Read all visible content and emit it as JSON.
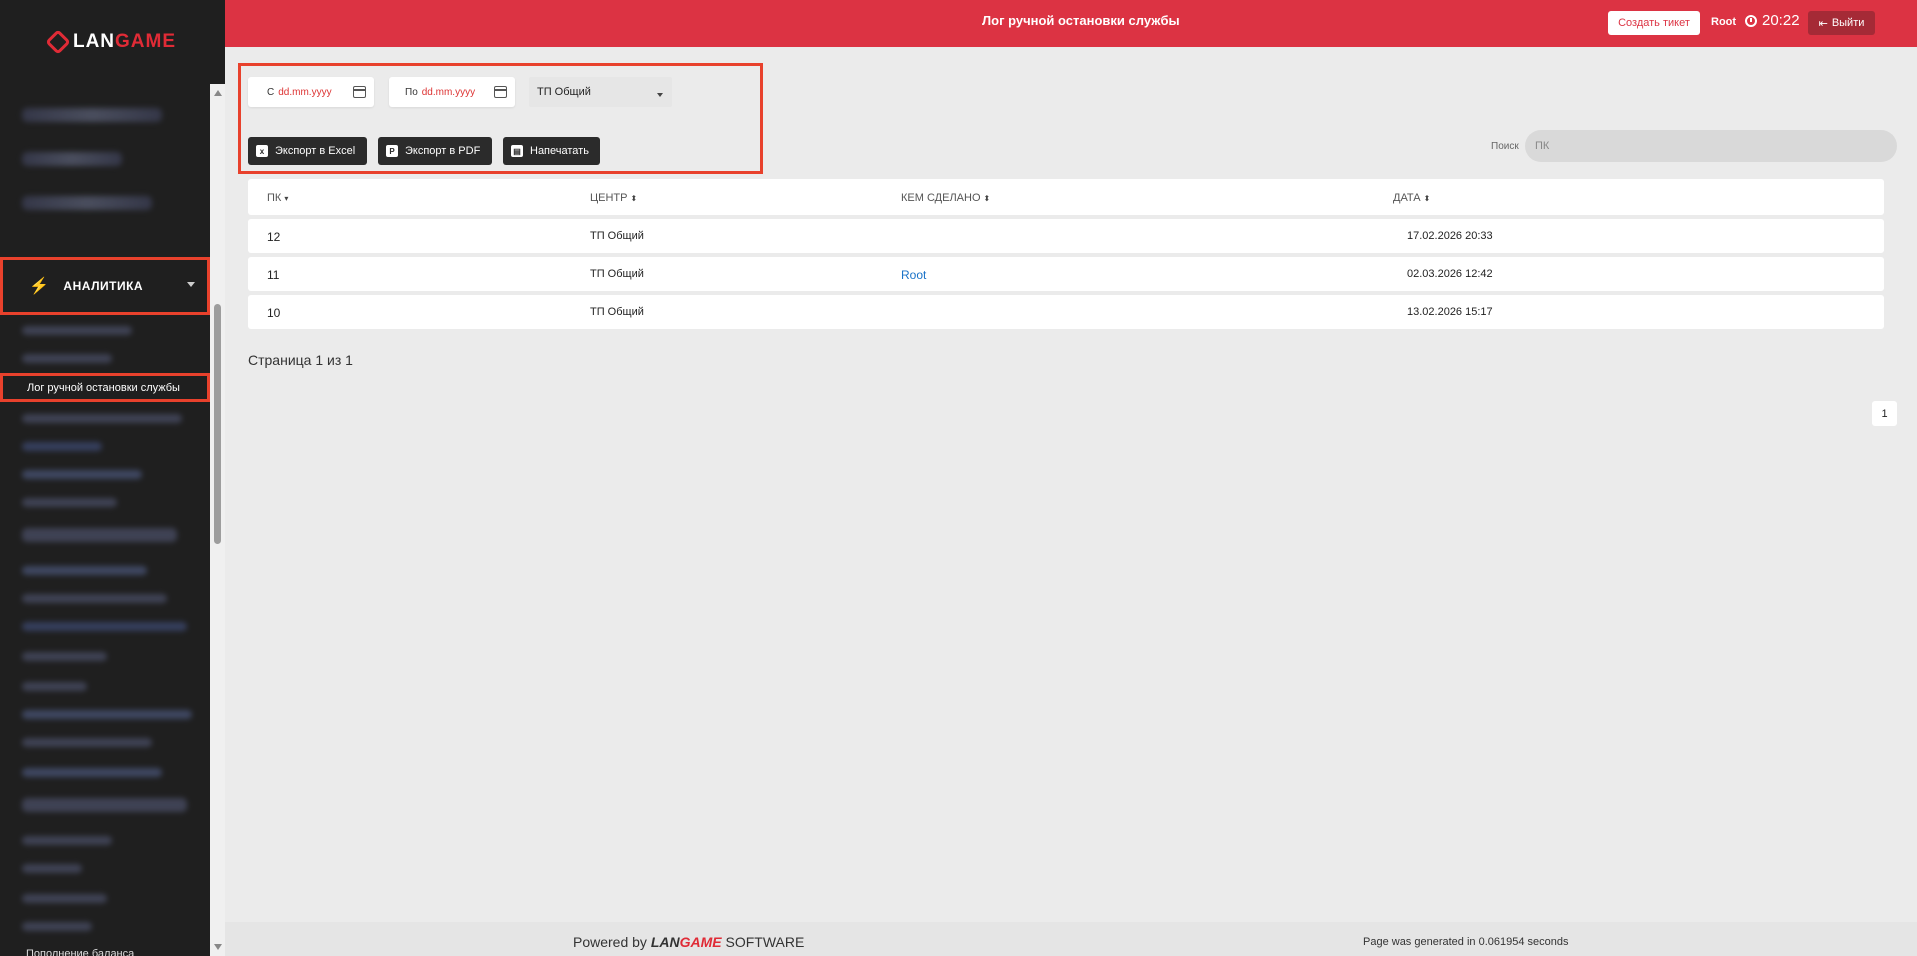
{
  "app": {
    "logo": {
      "prefix": "LAN",
      "accent": "GAME"
    },
    "brand_color": "#dc3343",
    "highlight_color": "#e8412c"
  },
  "sidebar": {
    "section_label": "АНАЛИТИКА",
    "section_icon": "bolt-icon",
    "active_item": "Лог ручной остановки службы",
    "footer_text": "Пополнение баланса"
  },
  "header": {
    "title": "Лог ручной остановки службы",
    "create_ticket_label": "Создать тикет",
    "user": "Root",
    "time": "20:22",
    "logout_label": "Выйти"
  },
  "filters": {
    "date_from": {
      "prefix": "С",
      "placeholder": "dd.mm.yyyy"
    },
    "date_to": {
      "prefix": "По",
      "placeholder": "dd.mm.yyyy"
    },
    "center_select": "ТП Общий",
    "export_excel_label": "Экспорт в Excel",
    "export_pdf_label": "Экспорт в PDF",
    "print_label": "Напечатать"
  },
  "search": {
    "label": "Поиск",
    "placeholder": "ПК"
  },
  "table": {
    "headers": [
      "ПК",
      "ЦЕНТР",
      "КЕМ СДЕЛАНО",
      "ДАТА"
    ],
    "rows": [
      {
        "pk": "12",
        "center": "ТП Общий",
        "by": "",
        "date": "17.02.2026 20:33"
      },
      {
        "pk": "11",
        "center": "ТП Общий",
        "by": "Root",
        "date": "02.03.2026 12:42"
      },
      {
        "pk": "10",
        "center": "ТП Общий",
        "by": "",
        "date": "13.02.2026 15:17"
      }
    ]
  },
  "pagination": {
    "info": "Страница 1 из 1",
    "current_page": "1"
  },
  "footer": {
    "powered_prefix": "Powered by",
    "brand_prefix": "LAN",
    "brand_accent": "GAME",
    "suffix": "SOFTWARE",
    "generated": "Page was generated in 0.061954 seconds"
  }
}
